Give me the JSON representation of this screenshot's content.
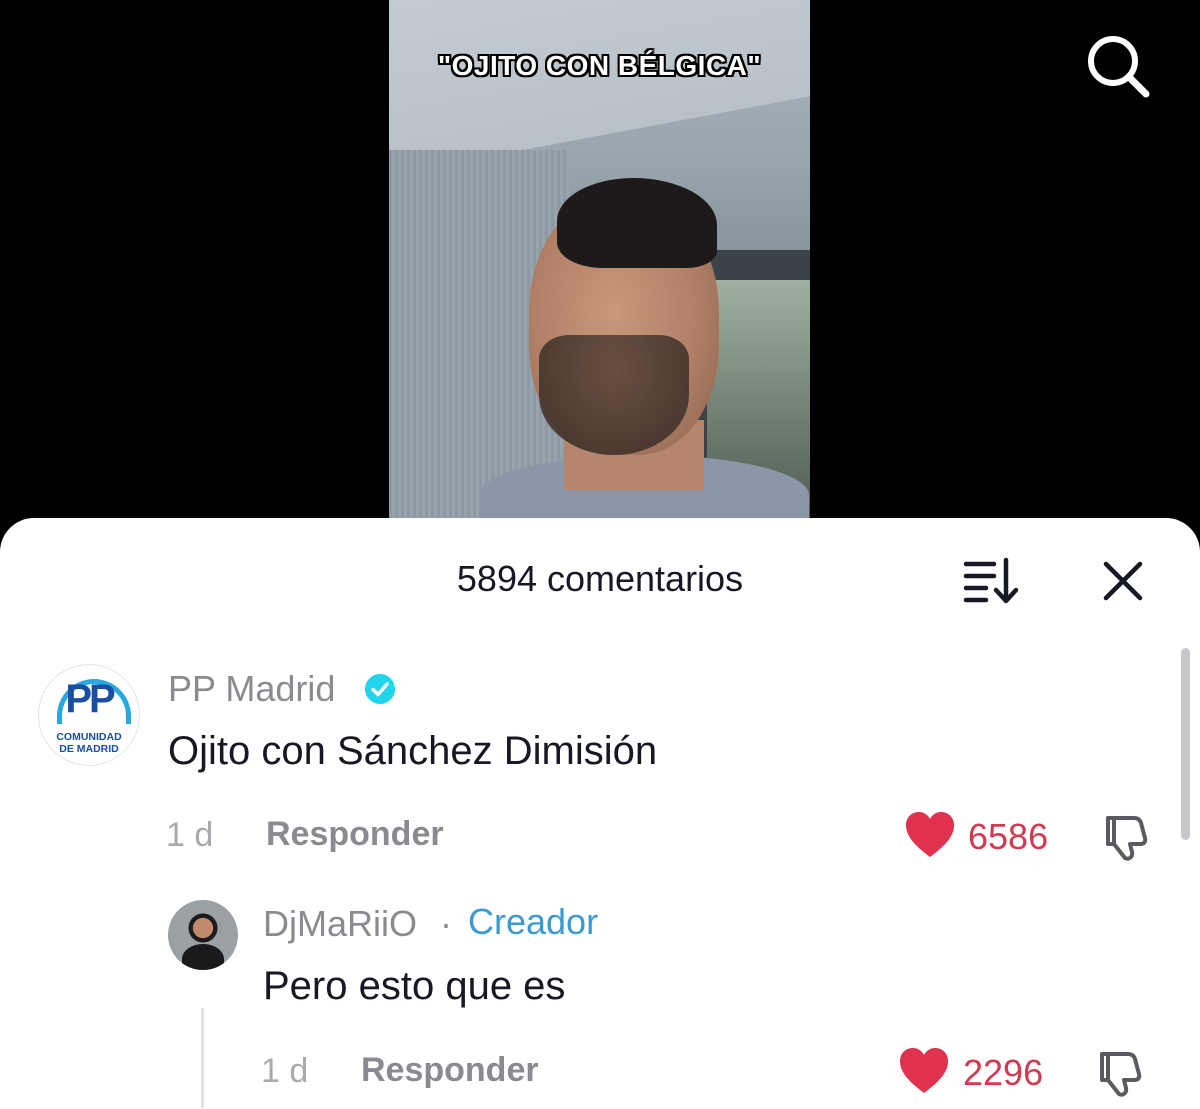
{
  "video": {
    "caption": "\"OJITO CON BÉLGICA\""
  },
  "sheet": {
    "title": "5894 comentarios"
  },
  "comments": [
    {
      "username": "PP Madrid",
      "verified": true,
      "avatar_text_top": "PP",
      "avatar_text_line1": "COMUNIDAD",
      "avatar_text_line2": "DE MADRID",
      "text": "Ojito con Sánchez Dimisión",
      "age": "1 d",
      "reply_label": "Responder",
      "likes": "6586",
      "replies": [
        {
          "username": "DjMaRiiO",
          "separator": "·",
          "badge": "Creador",
          "text": "Pero esto que es",
          "age": "1 d",
          "reply_label": "Responder",
          "likes": "2296"
        }
      ]
    }
  ],
  "colors": {
    "like": "#d33a52",
    "creator_badge": "#3b9acf",
    "verified_badge": "#20d5ec"
  },
  "icons": [
    "search-icon",
    "sort-icon",
    "close-icon",
    "verified-icon",
    "heart-icon",
    "dislike-icon"
  ]
}
